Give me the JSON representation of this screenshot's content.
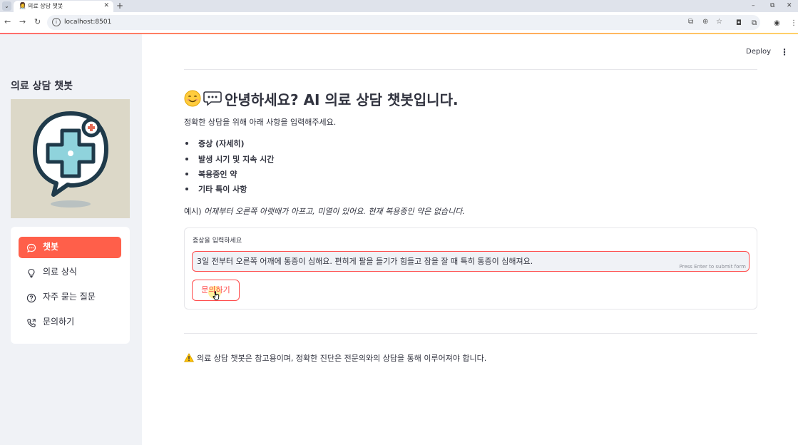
{
  "browser": {
    "tab_title": "의료 상담 챗봇",
    "url": "localhost:8501"
  },
  "header": {
    "deploy_label": "Deploy"
  },
  "sidebar": {
    "title": "의료 상담 챗봇",
    "menu": [
      {
        "label": "챗봇",
        "icon": "chat-dots-icon",
        "active": true
      },
      {
        "label": "의료 상식",
        "icon": "lightbulb-icon",
        "active": false
      },
      {
        "label": "자주 묻는 질문",
        "icon": "question-circle-icon",
        "active": false
      },
      {
        "label": "문의하기",
        "icon": "telephone-icon",
        "active": false
      }
    ]
  },
  "main": {
    "title_emoji": "😊💬",
    "title": "안녕하세요? AI 의료 상담 챗봇입니다.",
    "intro": "정확한 상담을 위해 아래 사항을 입력해주세요.",
    "bullets": [
      "증상 (자세히)",
      "발생 시기 및 지속 시간",
      "복용중인 약",
      "기타 특이 사항"
    ],
    "example_prefix": "예시) ",
    "example_text": "어제부터 오른쪽 아랫배가 아프고, 미열이 있어요. 현재 복용중인 약은 없습니다.",
    "form": {
      "label": "증상을 입력하세요",
      "value": "3일 전부터 오른쪽 어깨에 통증이 심해요. 편히게 팔을 들기가 힘들고 잠을 잘 때 특히 통증이 심해져요.",
      "hint": "Press Enter to submit form",
      "submit_label": "문의하기"
    },
    "warning": "의료 상담 챗봇은 참고용이며, 정확한 진단은 전문의와의 상담을 통해 이루어져야 합니다."
  },
  "colors": {
    "accent": "#ff4b4b",
    "active_menu": "#ff5f4a",
    "sidebar_bg": "#f0f2f6",
    "text": "#31333f"
  }
}
